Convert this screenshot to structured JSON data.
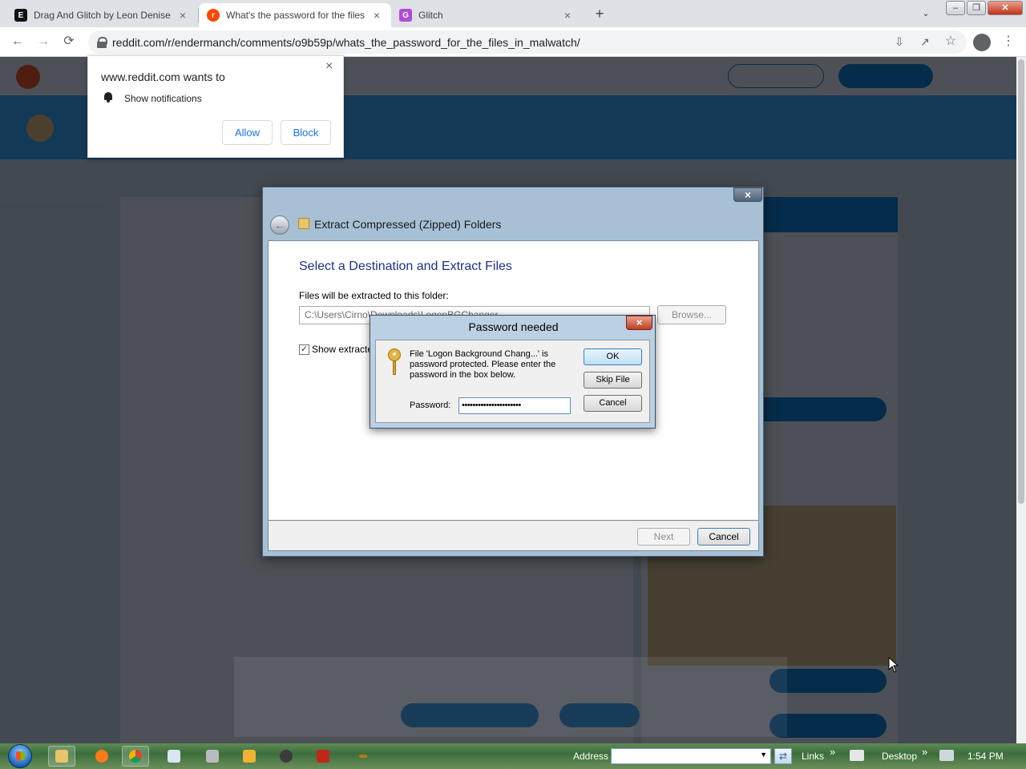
{
  "browser": {
    "tabs": [
      {
        "title": "Drag And Glitch by Leon Denise",
        "favicon": "E",
        "favicon_color": "#111111",
        "active": false
      },
      {
        "title": "What's the password for the files",
        "favicon": "r",
        "favicon_color": "#ff4500",
        "active": true
      },
      {
        "title": "Glitch",
        "favicon": "G",
        "favicon_color": "#b04bd6",
        "active": false
      }
    ],
    "tab_close": "×",
    "new_tab": "+",
    "tab_search_icon": "chevron-down-icon",
    "url": "reddit.com/r/endermanch/comments/o9b59p/whats_the_password_for_the_files_in_malwatch/",
    "nav": {
      "back": "←",
      "forward": "→",
      "reload": "⟳"
    },
    "toolbar_icons": [
      "install-icon",
      "share-icon",
      "star-icon",
      "profile-icon",
      "menu-icon"
    ]
  },
  "notification_prompt": {
    "title": "www.reddit.com wants to",
    "permission": "Show notifications",
    "allow": "Allow",
    "block": "Block",
    "close": "×"
  },
  "extract_wizard": {
    "window_title": "Extract Compressed (Zipped) Folders",
    "close": "×",
    "heading": "Select a Destination and Extract Files",
    "folder_label": "Files will be extracted to this folder:",
    "folder_path": "C:\\Users\\Cirno\\Downloads\\LogonBGChanger",
    "browse": "Browse...",
    "show_extracted_label": "Show extracte",
    "show_extracted_checked": true,
    "next": "Next",
    "cancel": "Cancel"
  },
  "password_dialog": {
    "title": "Password needed",
    "close": "×",
    "message": "File 'Logon Background Chang...' is password protected.  Please enter the password in the box below.",
    "password_label": "Password:",
    "password_value": "••••••••••••••••••••••",
    "ok": "OK",
    "skip": "Skip File",
    "cancel": "Cancel"
  },
  "taskbar": {
    "address_label": "Address",
    "links_label": "Links",
    "desktop_label": "Desktop",
    "chevron": "»",
    "time": "1:54 PM",
    "apps": [
      "explorer-icon",
      "firefox-icon",
      "chrome-icon",
      "notepad-icon",
      "printer-icon",
      "media-player-icon",
      "app-icon",
      "app2-icon",
      "app3-icon"
    ]
  },
  "colors": {
    "chrome_tabstrip": "#dee1e6",
    "reddit_banner": "#33a8ff",
    "dialog_heading": "#1e3287",
    "link_blue": "#1a73e8"
  }
}
